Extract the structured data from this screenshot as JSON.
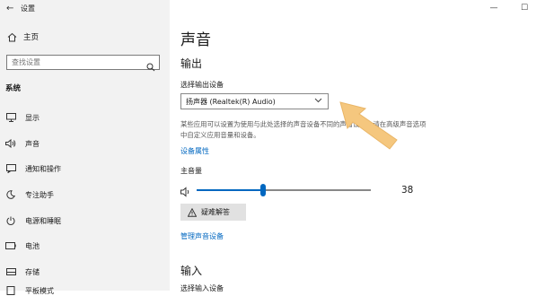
{
  "window": {
    "title": "设置",
    "back": "←",
    "minimize": "—",
    "maximize": "☐"
  },
  "sidebar": {
    "home_label": "主页",
    "search_placeholder": "查找设置",
    "section": "系统",
    "items": [
      {
        "label": "显示",
        "icon": "monitor-icon"
      },
      {
        "label": "声音",
        "icon": "speaker-icon"
      },
      {
        "label": "通知和操作",
        "icon": "notification-icon"
      },
      {
        "label": "专注助手",
        "icon": "moon-icon"
      },
      {
        "label": "电源和睡眠",
        "icon": "power-icon"
      },
      {
        "label": "电池",
        "icon": "battery-icon"
      },
      {
        "label": "存储",
        "icon": "storage-icon"
      },
      {
        "label": "平板模式",
        "icon": "tablet-icon"
      }
    ]
  },
  "main": {
    "title": "声音",
    "output_heading": "输出",
    "select_device_label": "选择输出设备",
    "selected_device": "扬声器 (Realtek(R) Audio)",
    "description": "某些应用可以设置为使用与此处选择的声音设备不同的声音设备。请在高级声音选项中自定义应用音量和设备。",
    "device_properties_link": "设备属性",
    "volume_label": "主音量",
    "volume_value": "38",
    "troubleshoot_label": "疑难解答",
    "manage_devices_link": "管理声音设备",
    "input_heading": "输入",
    "select_input_label": "选择输入设备"
  },
  "colors": {
    "accent": "#0067c0",
    "arrow": "#f5c77e",
    "sidebar_bg": "#f2f2f2"
  }
}
